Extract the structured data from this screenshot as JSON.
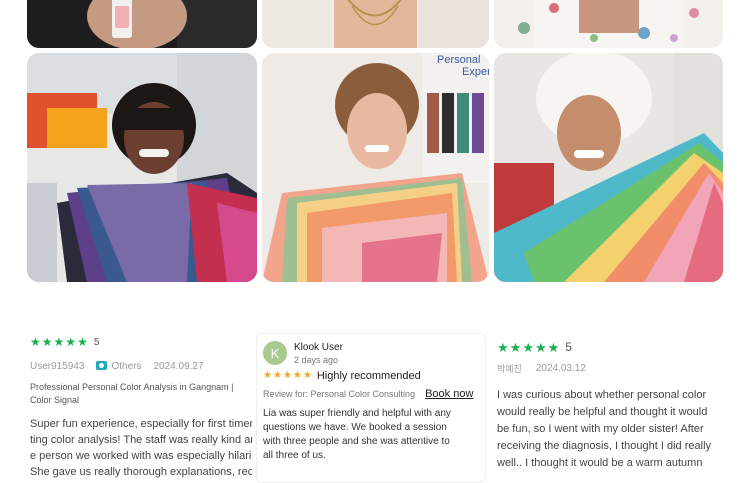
{
  "reviews": [
    {
      "rating": "5",
      "user": "User915943",
      "badge": "Others",
      "date": "2024.09.27",
      "title": "Professional Personal Color Analysis in Gangnam | Color Signal",
      "text_lines": [
        "Super fun experience, especially for first timers get",
        "ting color analysis! The staff was really kind and th",
        "e person we worked with was especially hilarious.",
        "She gave us really thorough explanations, recomm"
      ]
    },
    {
      "avatar_letter": "K",
      "user": "Klook User",
      "time": "2 days ago",
      "headline": "Highly recommended",
      "review_for": "Review for: Personal Color Consulting",
      "book_now": "Book now",
      "text_lines": [
        "Lia was super friendly and helpful with any",
        "questions we have. We booked a session",
        "with three people and she was attentive to",
        "all three of us."
      ]
    },
    {
      "rating": "5",
      "user": "박예진",
      "date": "2024.03.12",
      "text_lines": [
        "I was curious about whether personal color",
        "would really be helpful and thought it would",
        "be fun, so I went with my older sister! After",
        "receiving the diagnosis, I thought I did really",
        "well.. I thought it would be a warm autumn"
      ]
    }
  ],
  "photo_sign": "Personal Exper",
  "colors": {
    "star_green": "#19b04c",
    "avatar_green": "#a9c98f",
    "badge_teal": "#21a9b6"
  },
  "icons": [
    "star-icon",
    "camera-icon",
    "avatar"
  ]
}
